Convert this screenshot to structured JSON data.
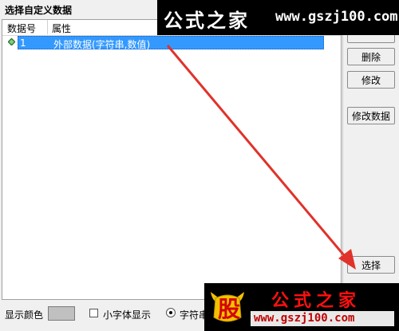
{
  "window": {
    "title": "选择自定义数据"
  },
  "table": {
    "columns": [
      "数据号",
      "属性"
    ],
    "rows": [
      {
        "id": "1",
        "attribute": "外部数据(字符串,数值)"
      }
    ]
  },
  "buttons": {
    "delete": "删除",
    "modify": "修改",
    "modify_data": "修改数据",
    "select": "选择"
  },
  "status": {
    "display_color_label": "显示颜色",
    "display_color": "#c0c0c0",
    "small_font_label": "小字体显示",
    "string_label": "字符串",
    "small_font_checked": false,
    "string_selected": true
  },
  "watermark_top": {
    "title": "公式之家",
    "url": "www.gszj100.com"
  },
  "watermark_bottom": {
    "logo_char": "股",
    "title": "公式之家",
    "url": "www.gszj100.com"
  },
  "colors": {
    "selection": "#3399ff",
    "arrow": "#e0322b"
  }
}
